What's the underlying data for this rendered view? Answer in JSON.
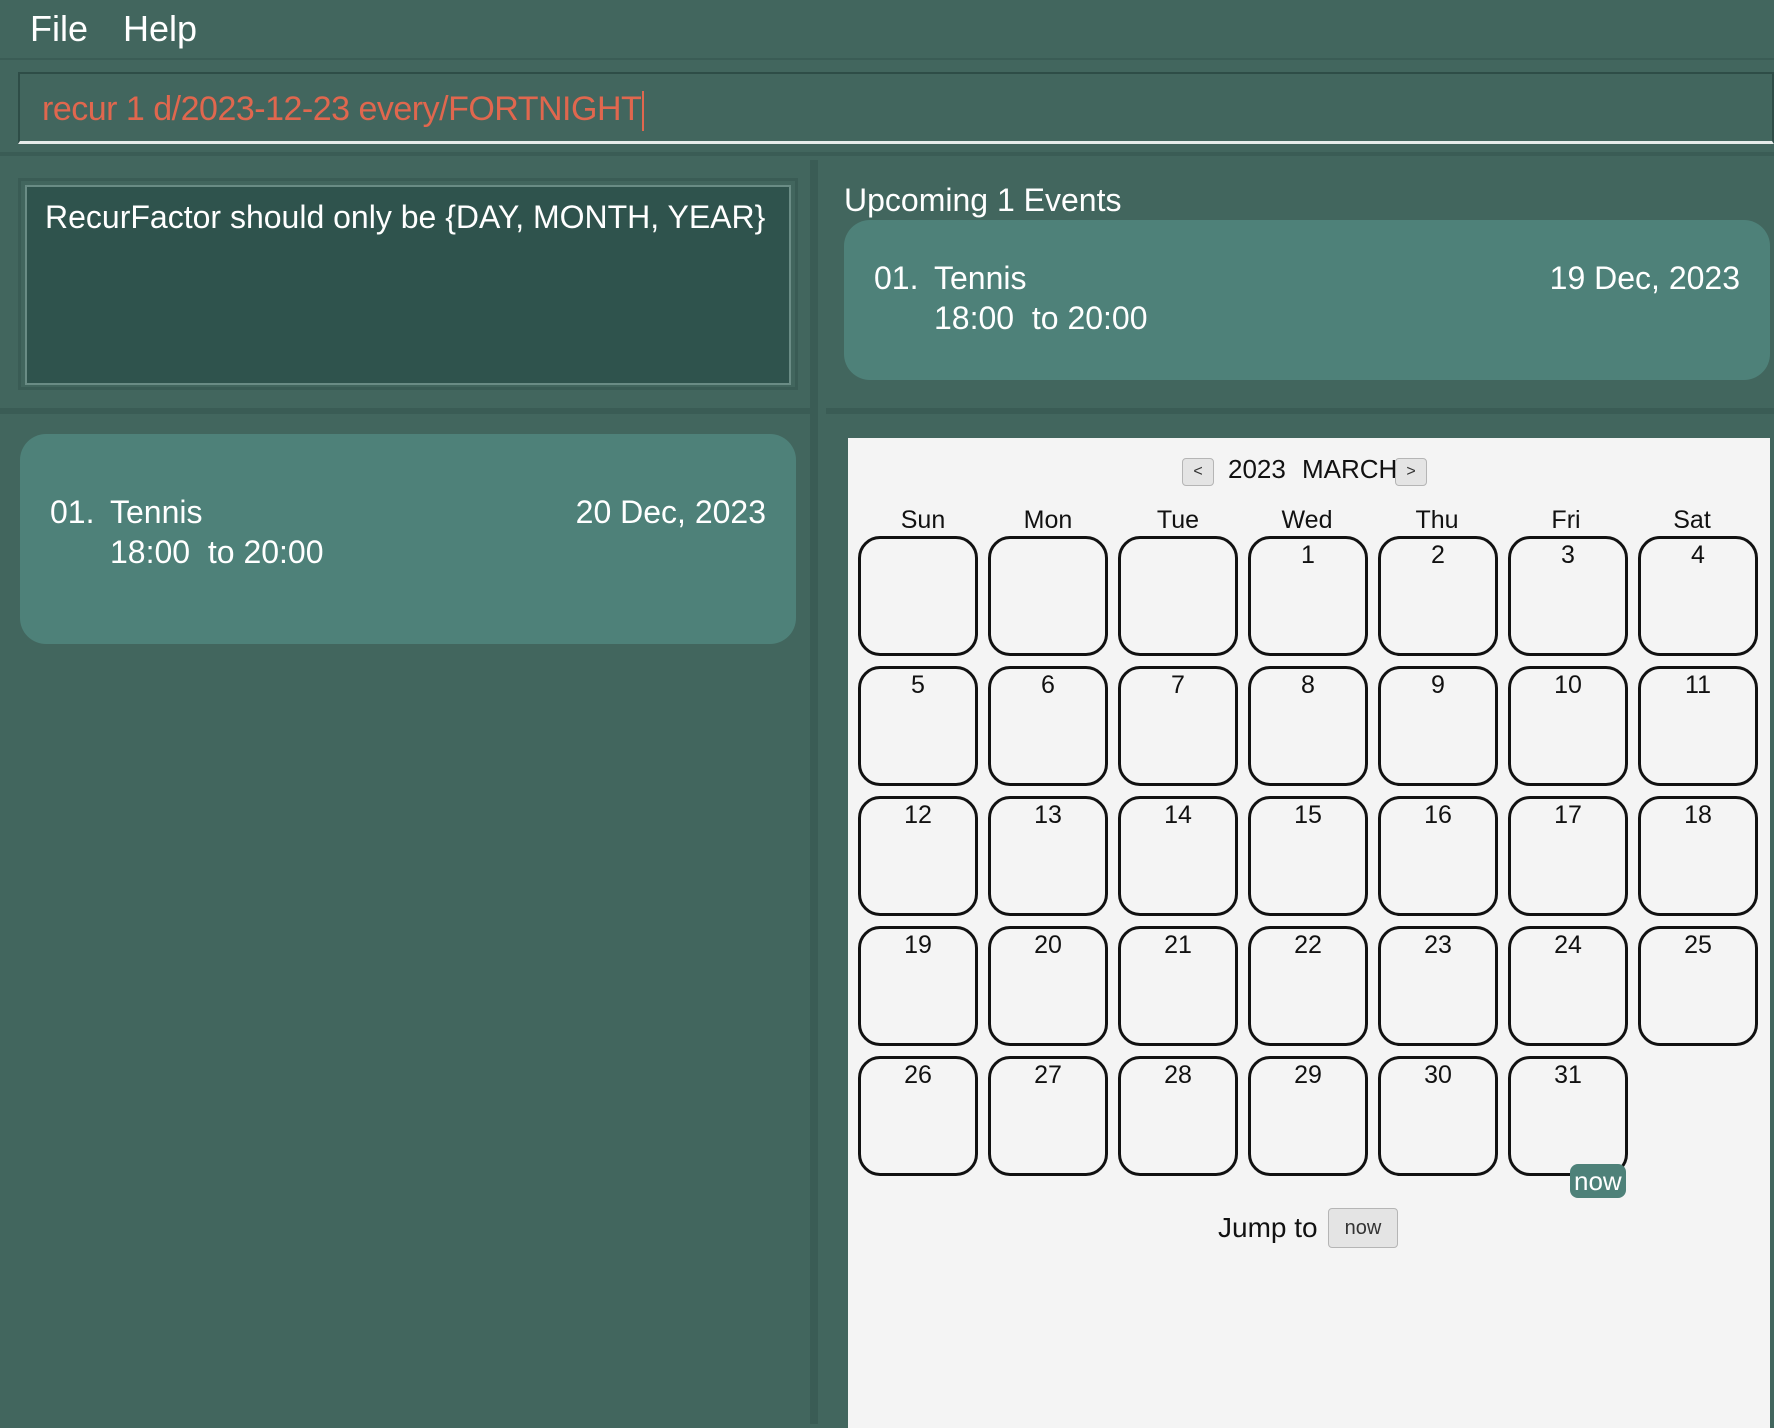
{
  "menu": {
    "file": "File",
    "help": "Help"
  },
  "command": {
    "value": "recur 1 d/2023-12-23 every/FORTNIGHT"
  },
  "result": {
    "message": "RecurFactor should only be {DAY, MONTH, YEAR}"
  },
  "event_list": [
    {
      "index": "01.",
      "name": "Tennis",
      "date": "20 Dec, 2023",
      "time": "18:00  to 20:00"
    }
  ],
  "upcoming": {
    "title": "Upcoming 1 Events",
    "events": [
      {
        "index": "01.",
        "name": "Tennis",
        "date": "19 Dec, 2023",
        "time": "18:00  to 20:00"
      }
    ]
  },
  "calendar": {
    "prev_label": "<",
    "next_label": ">",
    "year": "2023",
    "month": "MARCH",
    "weekdays": [
      "Sun",
      "Mon",
      "Tue",
      "Wed",
      "Thu",
      "Fri",
      "Sat"
    ],
    "days": [
      "",
      "",
      "",
      "1",
      "2",
      "3",
      "4",
      "5",
      "6",
      "7",
      "8",
      "9",
      "10",
      "11",
      "12",
      "13",
      "14",
      "15",
      "16",
      "17",
      "18",
      "19",
      "20",
      "21",
      "22",
      "23",
      "24",
      "25",
      "26",
      "27",
      "28",
      "29",
      "30",
      "31"
    ],
    "now_badge": "now",
    "jump_label": "Jump to",
    "jump_button": "now"
  },
  "colors": {
    "background": "#42665e",
    "card": "#4e8179",
    "result_box": "#2f534d",
    "command_text": "#e0674e",
    "calendar_bg": "#f4f4f4"
  }
}
